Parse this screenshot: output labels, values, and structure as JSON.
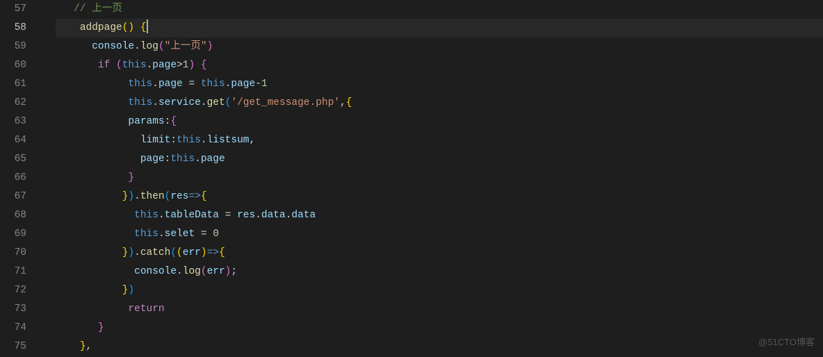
{
  "lineNumbers": [
    "57",
    "58",
    "59",
    "60",
    "61",
    "62",
    "63",
    "64",
    "65",
    "66",
    "67",
    "68",
    "69",
    "70",
    "71",
    "72",
    "73",
    "74",
    "75"
  ],
  "activeLine": "58",
  "code": {
    "l57": {
      "comment": "// 上一页"
    },
    "l58": {
      "fn": "addpage",
      "paren": "()",
      "brace": "{"
    },
    "l59": {
      "obj": "console",
      "method": "log",
      "str": "\"上一页\""
    },
    "l60": {
      "kw": "if",
      "this": "this",
      "prop": "page",
      "op": ">",
      "num": "1",
      "brace": "{"
    },
    "l61": {
      "this1": "this",
      "prop1": "page",
      "eq": " = ",
      "this2": "this",
      "prop2": "page",
      "op": "-",
      "num": "1"
    },
    "l62": {
      "this": "this",
      "prop": "service",
      "method": "get",
      "str": "'/get_message.php'",
      "comma": ",{"
    },
    "l63": {
      "prop": "params",
      "colon": ":{"
    },
    "l64": {
      "prop": "limit",
      "colon": ":",
      "this": "this",
      "prop2": "listsum",
      "comma": ","
    },
    "l65": {
      "prop": "page",
      "colon": ":",
      "this": "this",
      "prop2": "page"
    },
    "l66": {
      "brace": "}"
    },
    "l67": {
      "close": "}).",
      "method": "then",
      "open": "(",
      "arg": "res",
      "arrow": "=>{"
    },
    "l68": {
      "this1": "this",
      "prop1": "tableData",
      "eq": " = ",
      "arg": "res",
      "prop2": "data",
      "prop3": "data"
    },
    "l69": {
      "this": "this",
      "prop": "selet",
      "eq": " = ",
      "num": "0"
    },
    "l70": {
      "close": "}).",
      "method": "catch",
      "open": "((",
      "arg": "err",
      "arrow": ")=>{"
    },
    "l71": {
      "obj": "console",
      "method": "log",
      "open": "(",
      "arg": "err",
      "close": ");"
    },
    "l72": {
      "close": "})"
    },
    "l73": {
      "kw": "return"
    },
    "l74": {
      "brace": "}"
    },
    "l75": {
      "brace": "},"
    }
  },
  "watermark": "@51CTO博客"
}
